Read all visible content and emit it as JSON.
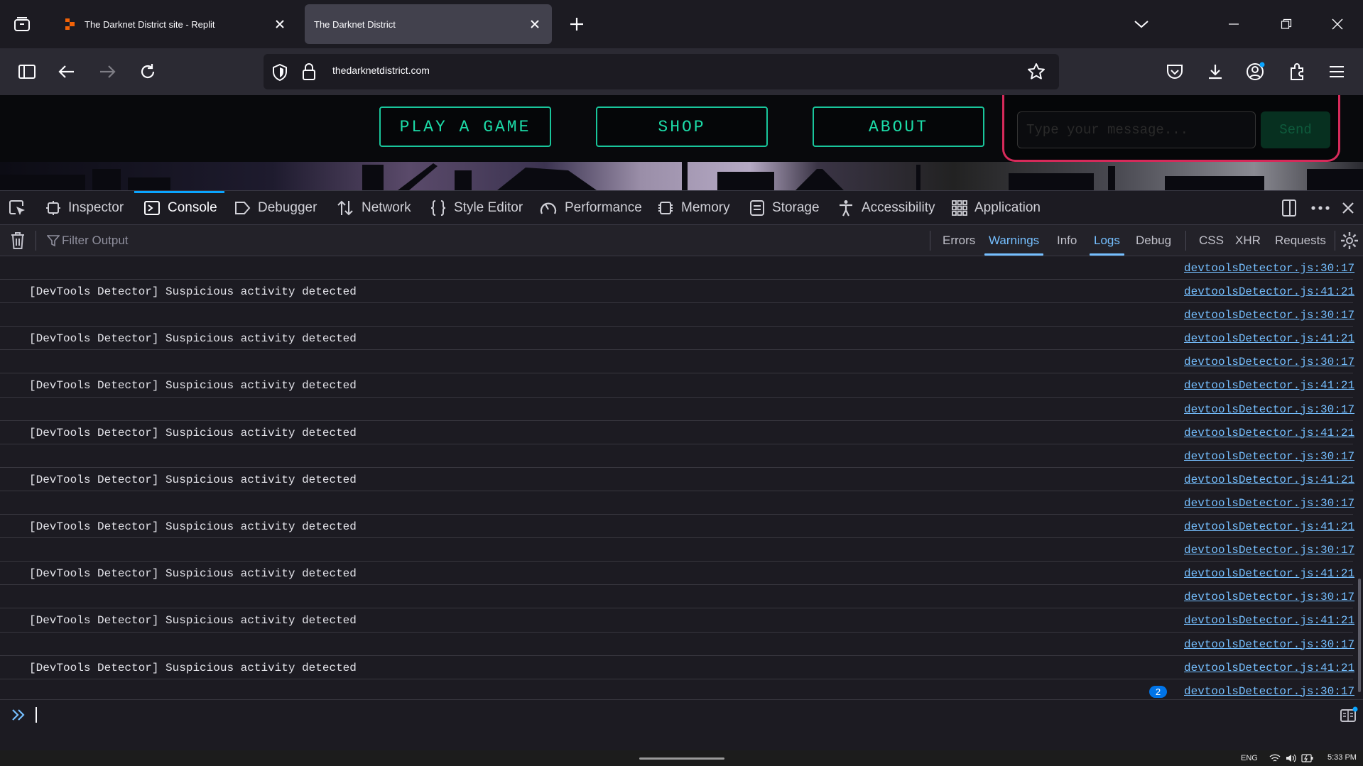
{
  "tabs": [
    {
      "title": "The Darknet District site - Replit",
      "icon": "replit-icon",
      "active": false
    },
    {
      "title": "The Darknet District",
      "active": true
    }
  ],
  "urlbar": {
    "url": "thedarknetdistrict.com"
  },
  "page": {
    "nav_buttons": [
      "PLAY A GAME",
      "SHOP",
      "ABOUT"
    ],
    "chat": {
      "placeholder": "Type your message...",
      "send_label": "Send"
    }
  },
  "devtools": {
    "tabs": [
      "Inspector",
      "Console",
      "Debugger",
      "Network",
      "Style Editor",
      "Performance",
      "Memory",
      "Storage",
      "Accessibility",
      "Application"
    ],
    "active_tab": "Console",
    "filter_placeholder": "Filter Output",
    "filters": {
      "levels": [
        "Errors",
        "Warnings",
        "Info",
        "Logs",
        "Debug"
      ],
      "types": [
        "CSS",
        "XHR",
        "Requests"
      ],
      "active": [
        "Warnings",
        "Logs"
      ]
    },
    "console_rows": [
      {
        "message": "",
        "source": "devtoolsDetector.js:30:17"
      },
      {
        "message": "[DevTools Detector] Suspicious activity detected",
        "source": "devtoolsDetector.js:41:21"
      },
      {
        "message": "",
        "source": "devtoolsDetector.js:30:17"
      },
      {
        "message": "[DevTools Detector] Suspicious activity detected",
        "source": "devtoolsDetector.js:41:21"
      },
      {
        "message": "",
        "source": "devtoolsDetector.js:30:17"
      },
      {
        "message": "[DevTools Detector] Suspicious activity detected",
        "source": "devtoolsDetector.js:41:21"
      },
      {
        "message": "",
        "source": "devtoolsDetector.js:30:17"
      },
      {
        "message": "[DevTools Detector] Suspicious activity detected",
        "source": "devtoolsDetector.js:41:21"
      },
      {
        "message": "",
        "source": "devtoolsDetector.js:30:17"
      },
      {
        "message": "[DevTools Detector] Suspicious activity detected",
        "source": "devtoolsDetector.js:41:21"
      },
      {
        "message": "",
        "source": "devtoolsDetector.js:30:17"
      },
      {
        "message": "[DevTools Detector] Suspicious activity detected",
        "source": "devtoolsDetector.js:41:21"
      },
      {
        "message": "",
        "source": "devtoolsDetector.js:30:17"
      },
      {
        "message": "[DevTools Detector] Suspicious activity detected",
        "source": "devtoolsDetector.js:41:21"
      },
      {
        "message": "",
        "source": "devtoolsDetector.js:30:17"
      },
      {
        "message": "[DevTools Detector] Suspicious activity detected",
        "source": "devtoolsDetector.js:41:21"
      },
      {
        "message": "",
        "source": "devtoolsDetector.js:30:17"
      },
      {
        "message": "[DevTools Detector] Suspicious activity detected",
        "source": "devtoolsDetector.js:41:21"
      },
      {
        "message": "",
        "source": "devtoolsDetector.js:30:17",
        "repeat": "2"
      }
    ]
  },
  "taskbar": {
    "lang": "ENG",
    "time": "5:33 PM"
  },
  "colors": {
    "accent": "#0aa5ff",
    "link": "#75bfff",
    "neon_green": "#19c59b",
    "neon_pink": "#d62a5a",
    "badge": "#0074e8"
  }
}
